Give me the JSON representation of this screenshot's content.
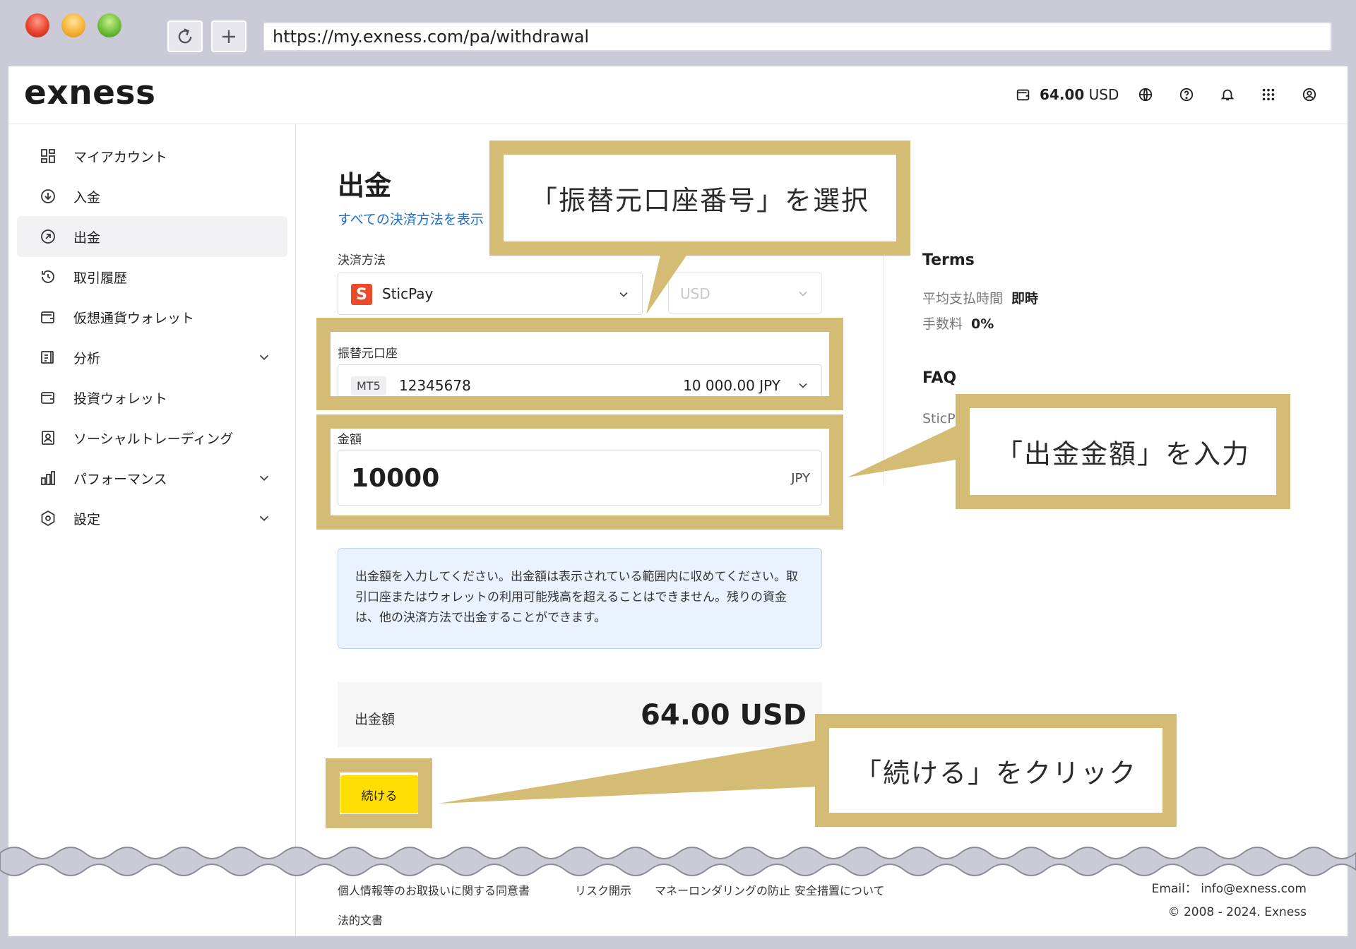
{
  "browser": {
    "url": "https://my.exness.com/pa/withdrawal"
  },
  "topbar": {
    "logo": "exness",
    "balance_amount": "64.00",
    "balance_currency": "USD"
  },
  "sidebar": {
    "items": [
      {
        "label": "マイアカウント",
        "icon": "dashboard-icon"
      },
      {
        "label": "入金",
        "icon": "deposit-icon"
      },
      {
        "label": "出金",
        "icon": "withdraw-icon",
        "active": true
      },
      {
        "label": "取引履歴",
        "icon": "history-icon"
      },
      {
        "label": "仮想通貨ウォレット",
        "icon": "wallet-icon"
      },
      {
        "label": "分析",
        "icon": "analytics-icon",
        "expandable": true
      },
      {
        "label": "投資ウォレット",
        "icon": "wallet-icon"
      },
      {
        "label": "ソーシャルトレーディング",
        "icon": "social-icon"
      },
      {
        "label": "パフォーマンス",
        "icon": "chart-icon",
        "expandable": true
      },
      {
        "label": "設定",
        "icon": "settings-icon",
        "expandable": true
      }
    ]
  },
  "main": {
    "title": "出金",
    "all_methods_link": "すべての決済方法を表示",
    "payment_method_label": "決済方法",
    "payment_method_value": "SticPay",
    "currency_value": "USD",
    "account_label": "振替元口座",
    "account_type": "MT5",
    "account_number": "12345678",
    "account_balance": "10 000.00 JPY",
    "amount_label": "金額",
    "amount_value": "10000",
    "amount_currency": "JPY",
    "info_text": "出金額を入力してください。出金額は表示されている範囲内に収めてください。取引口座またはウォレットの利用可能残高を超えることはできません。残りの資金は、他の決済方法で出金することができます。",
    "summary_label": "出金額",
    "summary_value": "64.00 USD",
    "continue_label": "続ける"
  },
  "terms": {
    "title": "Terms",
    "processing_label": "平均支払時間",
    "processing_value": "即時",
    "fee_label": "手数料",
    "fee_value": "0%",
    "faq_title": "FAQ",
    "faq_item": "SticPa"
  },
  "footer": {
    "links": [
      "個人情報等のお取扱いに関する同意書",
      "リスク開示",
      "マネーロンダリングの防止",
      "安全措置について",
      "法的文書"
    ],
    "email": "Email： info@exness.com",
    "copyright": "© 2008 - 2024. Exness"
  },
  "annotations": {
    "select_account": "「振替元口座番号」を選択",
    "enter_amount": "「出金金額」を入力",
    "click_continue": "「続ける」をクリック"
  },
  "colors": {
    "callout": "#d4bc74",
    "continue_button": "#ffde02",
    "link": "#1d6fc7"
  }
}
